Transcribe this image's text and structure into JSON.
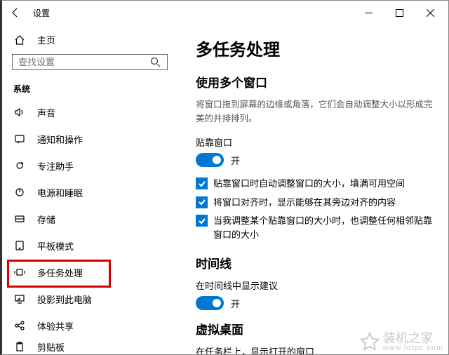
{
  "titlebar": {
    "title": "设置"
  },
  "sidebar": {
    "home": "主页",
    "search_placeholder": "查找设置",
    "group": "系统",
    "items": [
      {
        "label": "声音"
      },
      {
        "label": "通知和操作"
      },
      {
        "label": "专注助手"
      },
      {
        "label": "电源和睡眠"
      },
      {
        "label": "存储"
      },
      {
        "label": "平板模式"
      },
      {
        "label": "多任务处理"
      },
      {
        "label": "投影到此电脑"
      },
      {
        "label": "体验共享"
      },
      {
        "label": "剪贴板"
      }
    ]
  },
  "content": {
    "title": "多任务处理",
    "section1": {
      "heading": "使用多个窗口",
      "desc": "将窗口拖到屏幕的边缘或角落，它们会自动调整大小以形成完美的并排排列。",
      "snap_label": "贴靠窗口",
      "toggle_state": "开",
      "checks": [
        "贴靠窗口时自动调整窗口的大小，填满可用空间",
        "将窗口对齐时，显示能够在其旁边对齐的内容",
        "当我调整某个贴靠窗口的大小时，也调整任何相邻贴靠窗口的大小"
      ]
    },
    "section2": {
      "heading": "时间线",
      "label": "在时间线中显示建议",
      "toggle_state": "开"
    },
    "section3": {
      "heading": "虚拟桌面",
      "label": "在任务栏上，显示打开的窗口"
    }
  },
  "watermark": {
    "brand": "装机之家",
    "url": "www.lotpc.com"
  }
}
